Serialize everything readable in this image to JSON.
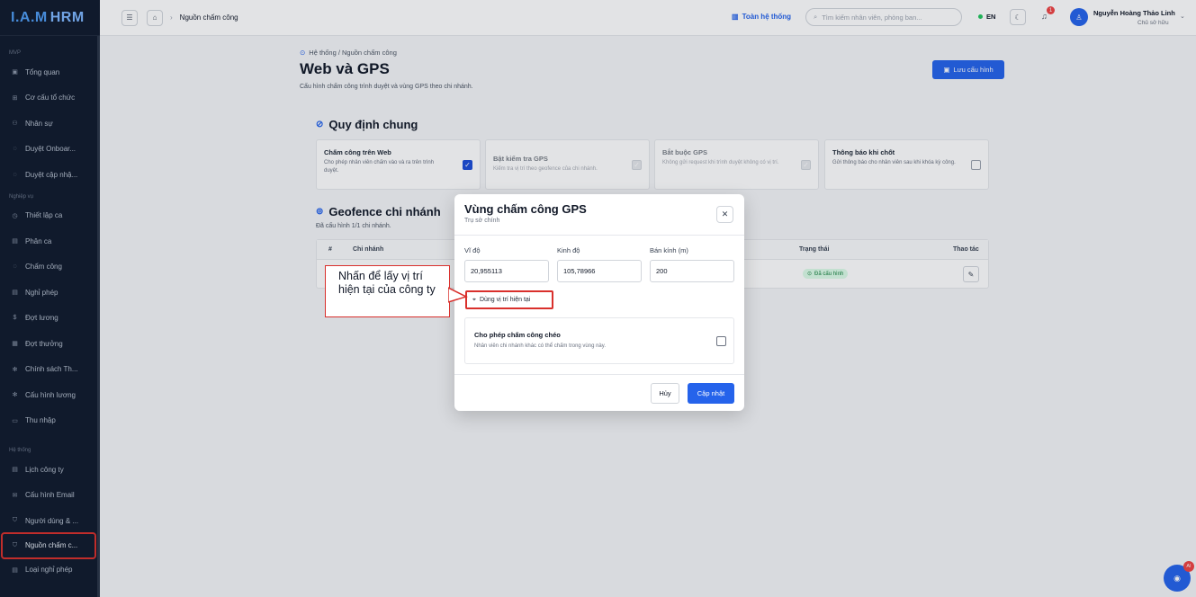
{
  "app": {
    "logo_part1": "I.A.M",
    "logo_part2": "HRM"
  },
  "sidebar": {
    "sections": [
      {
        "label": "MVP",
        "items": [
          {
            "label": "Tổng quan",
            "icon": "dashboard-icon"
          },
          {
            "label": "Cơ cấu tổ chức",
            "icon": "org-icon"
          },
          {
            "label": "Nhân sự",
            "icon": "users-icon"
          },
          {
            "label": "Duyệt Onboar...",
            "icon": "check-circle-icon"
          },
          {
            "label": "Duyệt cập nhậ...",
            "icon": "check-circle-icon"
          }
        ]
      },
      {
        "label": "Nghiệp vụ",
        "items": [
          {
            "label": "Thiết lập ca",
            "icon": "clock-icon"
          },
          {
            "label": "Phân ca",
            "icon": "calendar-icon"
          },
          {
            "label": "Chấm công",
            "icon": "check-circle-icon"
          },
          {
            "label": "Nghỉ phép",
            "icon": "calendar-icon"
          },
          {
            "label": "Đợt lương",
            "icon": "dollar-icon"
          },
          {
            "label": "Đợt thưởng",
            "icon": "gift-icon"
          },
          {
            "label": "Chính sách Th...",
            "icon": "settings-icon"
          },
          {
            "label": "Cấu hình lương",
            "icon": "settings-icon"
          },
          {
            "label": "Thu nhập",
            "icon": "wallet-icon"
          }
        ]
      },
      {
        "label": "Hệ thống",
        "items": [
          {
            "label": "Lịch công ty",
            "icon": "calendar-icon"
          },
          {
            "label": "Cấu hình Email",
            "icon": "mail-icon"
          },
          {
            "label": "Người dùng & ...",
            "icon": "shield-icon"
          },
          {
            "label": "Nguồn chấm c...",
            "icon": "shield-check-icon",
            "active": true
          },
          {
            "label": "Loại nghỉ phép",
            "icon": "calendar-icon"
          }
        ]
      }
    ]
  },
  "topbar": {
    "breadcrumb": "Nguồn chấm công",
    "system_link": "Toàn hệ thống",
    "search_placeholder": "Tìm kiếm nhân viên, phòng ban...",
    "language": "EN",
    "notification_count": "1",
    "user_name": "Nguyễn Hoàng Thảo Linh",
    "user_role": "Chủ sở hữu"
  },
  "page": {
    "breadcrumb": "Hệ thống / Nguồn chấm công",
    "title": "Web và GPS",
    "subtitle": "Cấu hình chấm công trình duyệt và vùng GPS theo chi nhánh.",
    "save_label": "Lưu cấu hình"
  },
  "general_rules": {
    "title": "Quy định chung",
    "cards": [
      {
        "title": "Chấm công trên Web",
        "desc": "Cho phép nhân viên chấm vào và ra trên trình duyệt.",
        "checked": true
      },
      {
        "title": "Bật kiểm tra GPS",
        "desc": "Kiểm tra vị trí theo geofence của chi nhánh.",
        "checked": true,
        "disabled": true
      },
      {
        "title": "Bắt buộc GPS",
        "desc": "Không gửi request khi trình duyệt không có vị trí.",
        "checked": true,
        "disabled": true
      },
      {
        "title": "Thông báo khi chốt",
        "desc": "Gửi thông báo cho nhân viên sau khi khóa kỳ công.",
        "checked": false
      }
    ]
  },
  "geofence": {
    "title": "Geofence chi nhánh",
    "subtitle": "Đã cấu hình 1/1 chi nhánh.",
    "columns": [
      "#",
      "Chi nhánh",
      "Trạng thái",
      "Thao tác"
    ],
    "rows": [
      {
        "status": "Đã cấu hình"
      }
    ]
  },
  "modal": {
    "title": "Vùng chấm công GPS",
    "subtitle": "Trụ sở chính",
    "lat_label": "Vĩ độ",
    "lat_value": "20,955113",
    "lng_label": "Kinh độ",
    "lng_value": "105,78966",
    "radius_label": "Bán kính (m)",
    "radius_value": "200",
    "use_location_label": "Dùng vị trí hiện tại",
    "cross_title": "Cho phép chấm công chéo",
    "cross_desc": "Nhân viên chi nhánh khác có thể chấm trong vùng này.",
    "cancel_label": "Hủy",
    "update_label": "Cập nhật"
  },
  "callout": {
    "text": "Nhấn để lấy vị trí hiện tại của công ty"
  },
  "ai": {
    "badge": "AI"
  },
  "colors": {
    "primary": "#2563eb",
    "sidebar_bg": "#101b2d",
    "highlight": "#d9302c",
    "success": "#15803d"
  }
}
